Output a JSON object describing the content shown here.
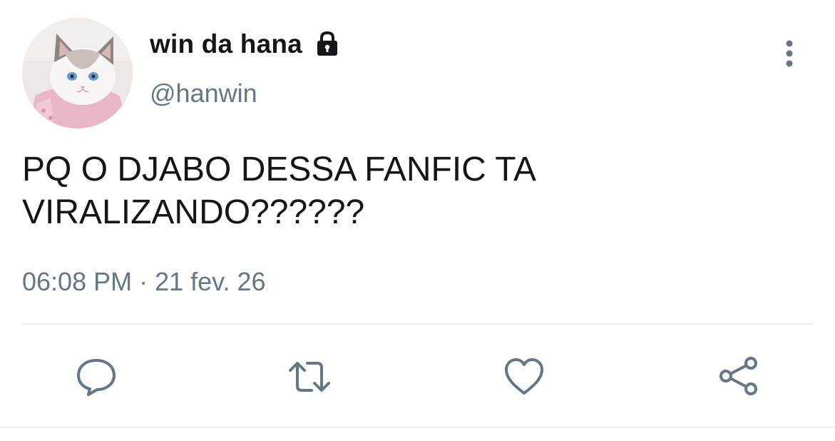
{
  "tweet": {
    "author": {
      "display_name": "win da hana",
      "handle": "@hanwin",
      "protected": true,
      "avatar": "cat-avatar"
    },
    "text": "PQ O DJABO DESSA FANFIC TA\nVIRALIZANDO??????",
    "timestamp": "06:08 PM · 21 fev. 26"
  },
  "icons": {
    "lock": "lock-icon",
    "more": "more-vertical-icon",
    "reply": "reply-icon",
    "retweet": "retweet-icon",
    "like": "heart-icon",
    "share": "share-icon"
  },
  "colors": {
    "text_primary": "#14171a",
    "text_secondary": "#657786",
    "icon": "#657786",
    "divider": "#e6ecf0"
  }
}
